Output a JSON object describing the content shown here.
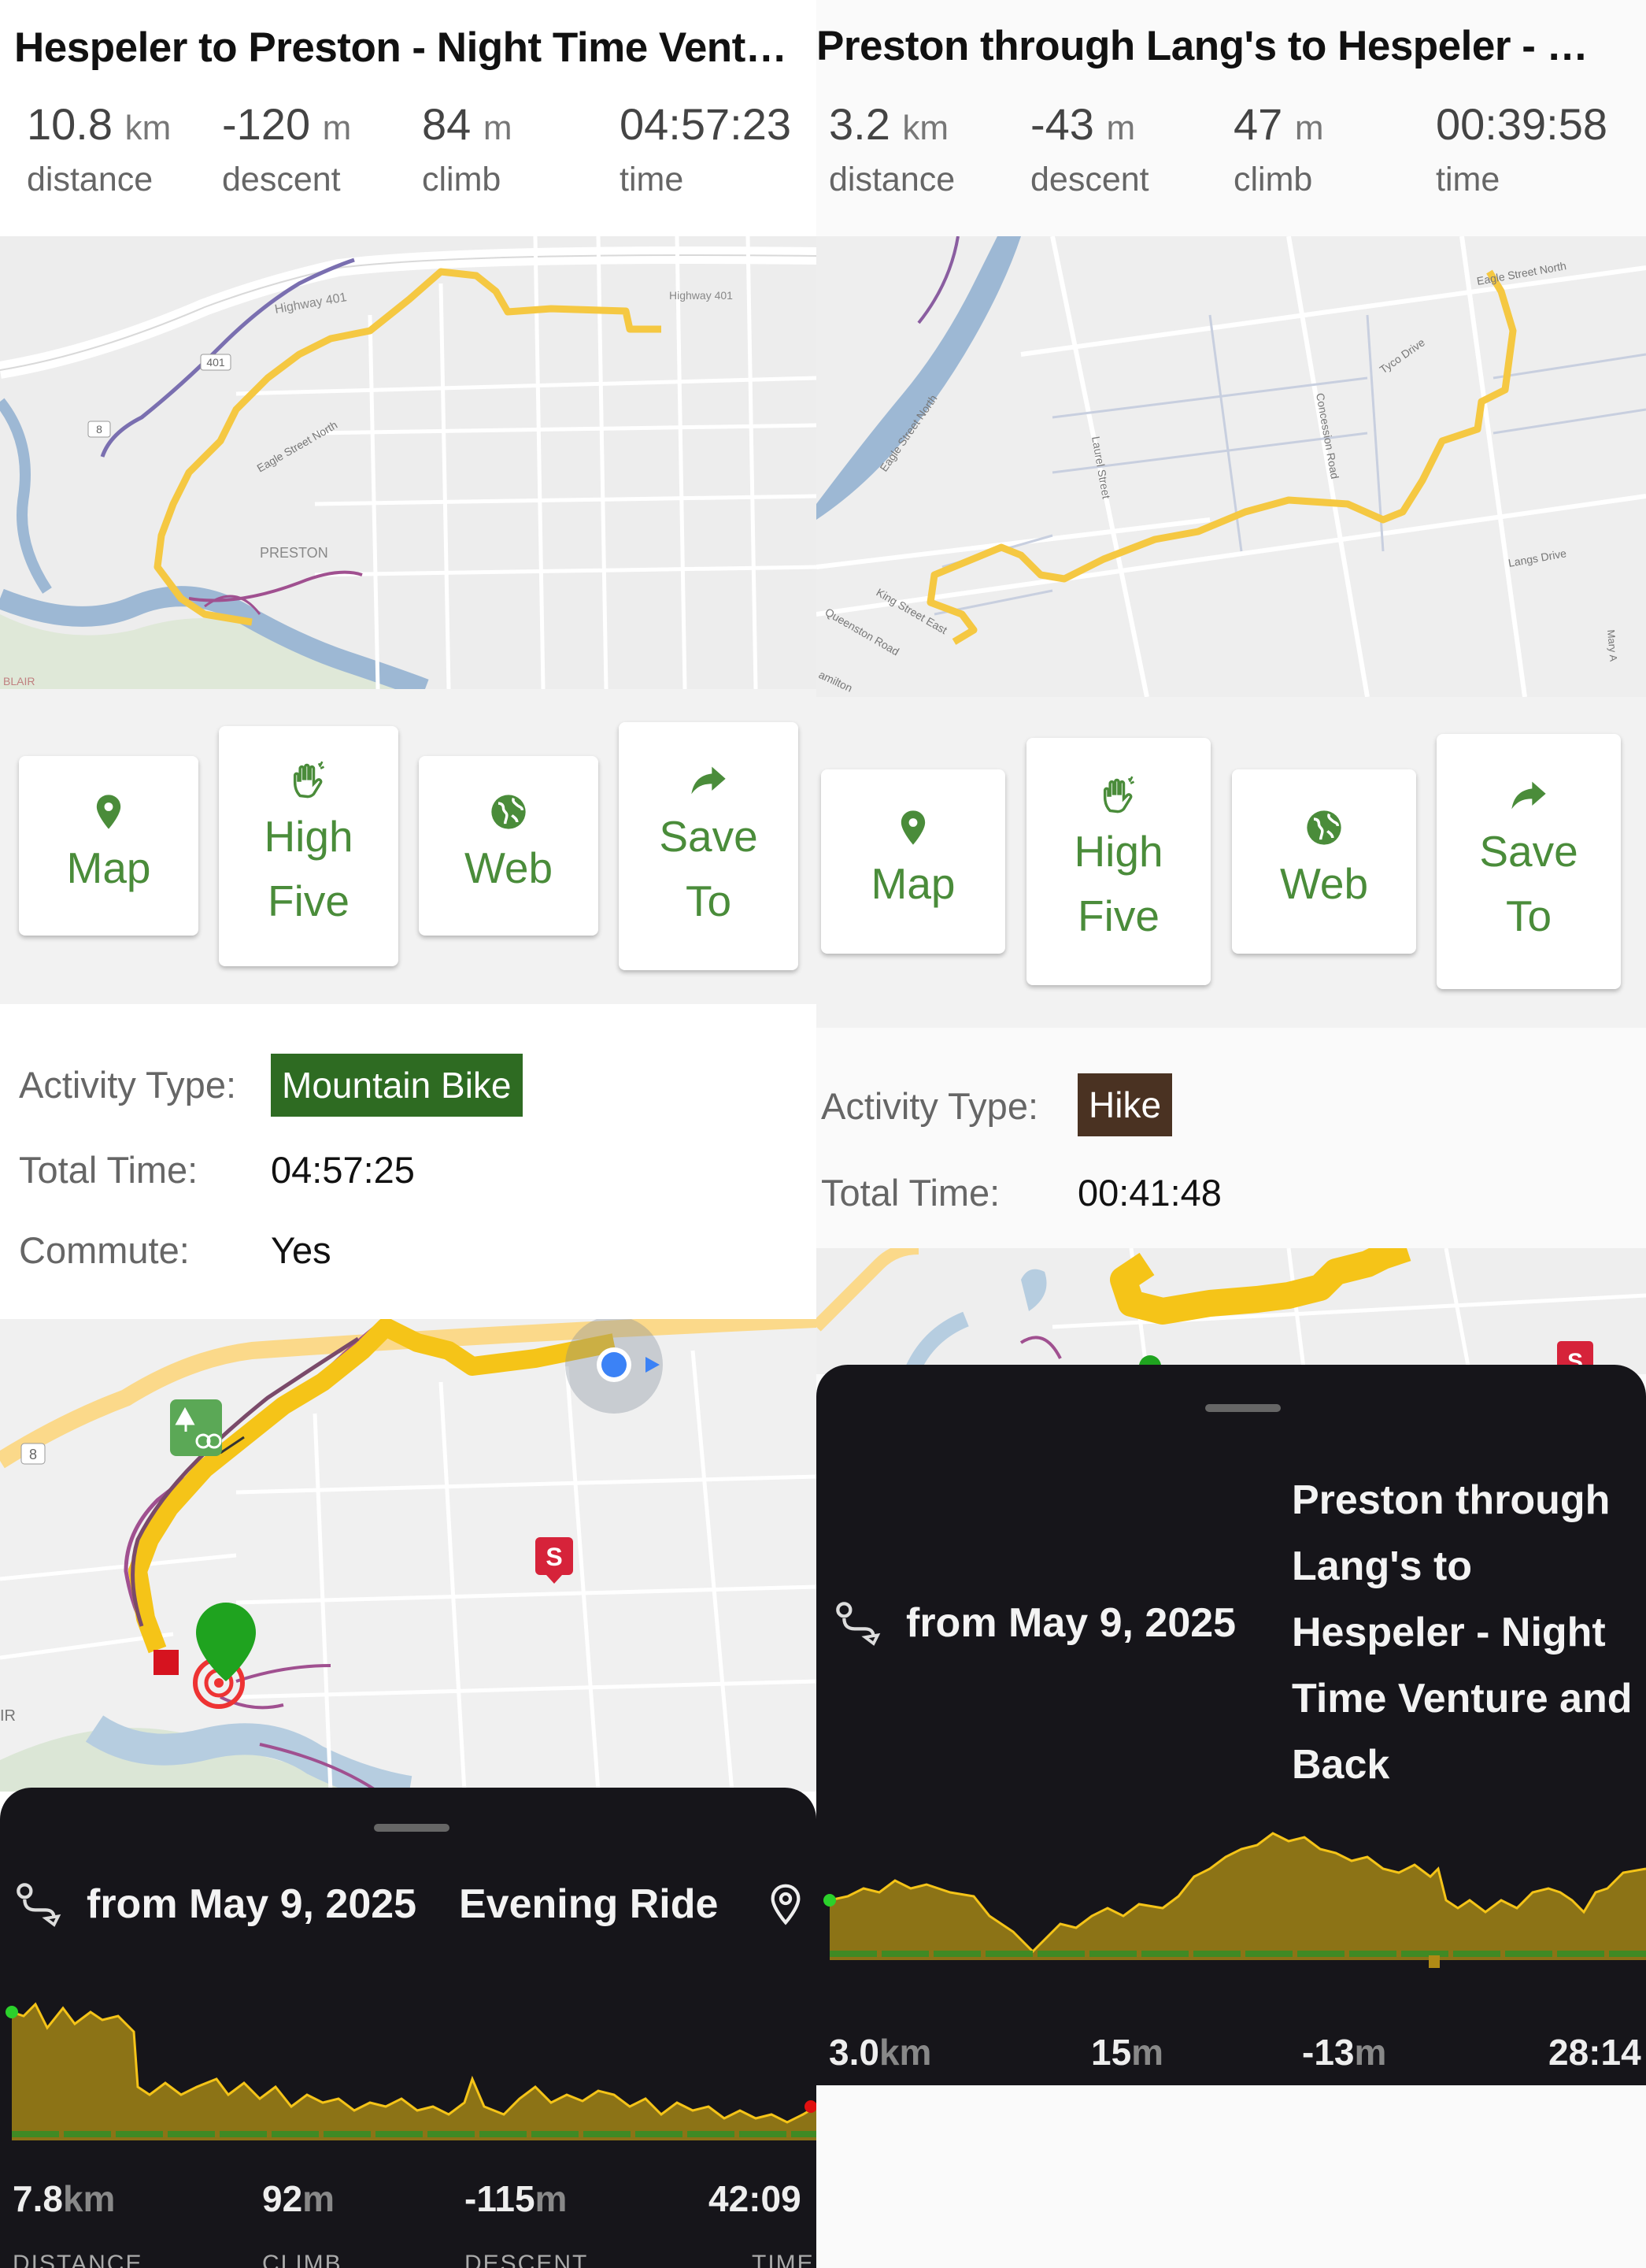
{
  "left": {
    "title": "Hespeler to Preston - Night Time Vent…",
    "stats": [
      {
        "value": "10.8",
        "unit": "km",
        "label": "distance"
      },
      {
        "value": "-120",
        "unit": "m",
        "label": "descent"
      },
      {
        "value": "84",
        "unit": "m",
        "label": "climb"
      },
      {
        "value": "04:57:23",
        "unit": "",
        "label": "time"
      }
    ],
    "map_labels": {
      "highway": "Highway 401",
      "highway2": "Highway 401",
      "route_401": "401",
      "route_8": "8",
      "preston": "PRESTON",
      "eagle": "Eagle Street North",
      "blair": "BLAIR"
    },
    "buttons": {
      "map": "Map",
      "high": "High",
      "five": "Five",
      "web": "Web",
      "save": "Save",
      "to": "To"
    },
    "activity_label": "Activity Type:",
    "activity_value": "Mountain Bike",
    "total_time_label": "Total Time:",
    "total_time_value": "04:57:25",
    "commute_label": "Commute:",
    "commute_value": "Yes",
    "map2_labels": {
      "route_8": "8",
      "s_marker": "S",
      "ir": "IR"
    },
    "sheet": {
      "from": "from May 9, 2025",
      "name": "Evening Ride",
      "stats": [
        {
          "value": "7.8",
          "unit": "km",
          "label": "DISTANCE"
        },
        {
          "value": "92",
          "unit": "m",
          "label": "CLIMB"
        },
        {
          "value": "-115",
          "unit": "m",
          "label": "DESCENT"
        },
        {
          "value": "42:09",
          "unit": "",
          "label": "TIME"
        }
      ]
    }
  },
  "right": {
    "title": "Preston through Lang's to Hespeler - …",
    "stats": [
      {
        "value": "3.2",
        "unit": "km",
        "label": "distance"
      },
      {
        "value": "-43",
        "unit": "m",
        "label": "descent"
      },
      {
        "value": "47",
        "unit": "m",
        "label": "climb"
      },
      {
        "value": "00:39:58",
        "unit": "",
        "label": "time"
      }
    ],
    "map_labels": {
      "eagle_n": "Eagle Street North",
      "tyco": "Tyco Drive",
      "eagle_st": "Eagle Street North",
      "laurel": "Laurel Street",
      "concession": "Concession Road",
      "langs": "Langs Drive",
      "king": "King Street East",
      "queenston": "Queenston Road",
      "hamilton": "amilton",
      "mary": "Mary A"
    },
    "buttons": {
      "map": "Map",
      "high": "High",
      "five": "Five",
      "web": "Web",
      "save": "Save",
      "to": "To"
    },
    "activity_label": "Activity Type:",
    "activity_value": "Hike",
    "total_time_label": "Total Time:",
    "total_time_value": "00:41:48",
    "map2_labels": {
      "s_marker": "S"
    },
    "sheet": {
      "from": "from May 9, 2025",
      "name_lines": [
        "Preston through",
        "Lang's to",
        "Hespeler - Night",
        "Time Venture and",
        "Back"
      ],
      "stats": [
        {
          "value": "3.0",
          "unit": "km"
        },
        {
          "value": "15",
          "unit": "m"
        },
        {
          "value": "-13",
          "unit": "m"
        },
        {
          "value": "28:14",
          "unit": ""
        }
      ]
    }
  },
  "colors": {
    "accent_green": "#4a8c3a",
    "route_yellow": "#f5c842",
    "mtb_badge": "#2e6b22",
    "hike_badge": "#4a3222",
    "sheet_bg": "#16151a",
    "elevation_fill": "#8c7316"
  }
}
